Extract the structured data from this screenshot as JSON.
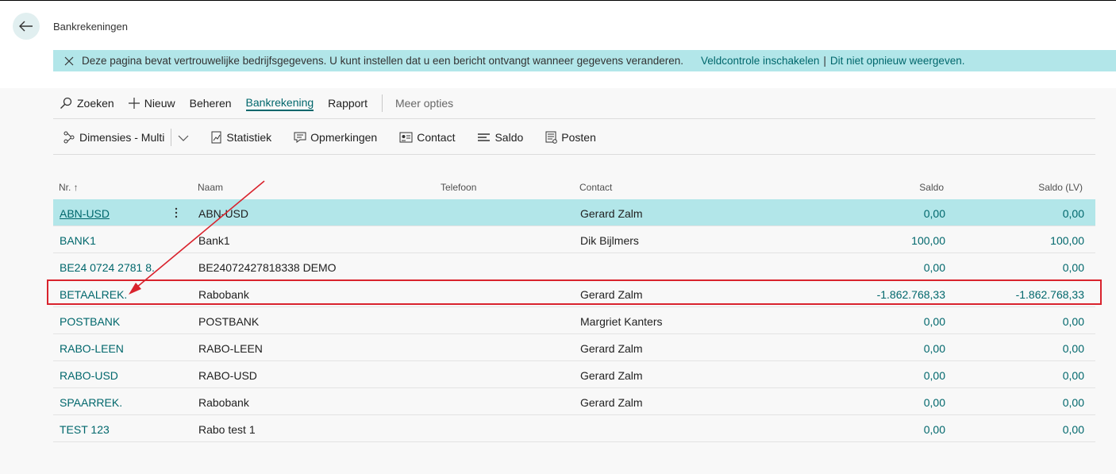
{
  "header": {
    "title": "Bankrekeningen"
  },
  "banner": {
    "message": "Deze pagina bevat vertrouwelijke bedrijfsgegevens. U kunt instellen dat u een bericht ontvangt wanneer gegevens veranderen.",
    "link1": "Veldcontrole inschakelen",
    "separator": "|",
    "link2": "Dit niet opnieuw weergeven."
  },
  "actionbar": {
    "search": "Zoeken",
    "new": "Nieuw",
    "manage": "Beheren",
    "bank_account": "Bankrekening",
    "report": "Rapport",
    "more": "Meer opties"
  },
  "toolbar": {
    "dimensions": "Dimensies - Multi",
    "statistics": "Statistiek",
    "comments": "Opmerkingen",
    "contact": "Contact",
    "balance": "Saldo",
    "entries": "Posten"
  },
  "table": {
    "headers": {
      "nr": "Nr. ↑",
      "naam": "Naam",
      "telefoon": "Telefoon",
      "contact": "Contact",
      "saldo": "Saldo",
      "saldo_lv": "Saldo (LV)"
    },
    "rows": [
      {
        "nr": "ABN-USD",
        "naam": "ABN-USD",
        "contact": "Gerard Zalm",
        "saldo": "0,00",
        "saldo_lv": "0,00"
      },
      {
        "nr": "BANK1",
        "naam": "Bank1",
        "contact": "Dik Bijlmers",
        "saldo": "100,00",
        "saldo_lv": "100,00"
      },
      {
        "nr": "BE24 0724 2781 8...",
        "naam": "BE24072427818338 DEMO",
        "contact": "",
        "saldo": "0,00",
        "saldo_lv": "0,00"
      },
      {
        "nr": "BETAALREK.",
        "naam": "Rabobank",
        "contact": "Gerard Zalm",
        "saldo": "-1.862.768,33",
        "saldo_lv": "-1.862.768,33"
      },
      {
        "nr": "POSTBANK",
        "naam": "POSTBANK",
        "contact": "Margriet Kanters",
        "saldo": "0,00",
        "saldo_lv": "0,00"
      },
      {
        "nr": "RABO-LEEN",
        "naam": "RABO-LEEN",
        "contact": "Gerard Zalm",
        "saldo": "0,00",
        "saldo_lv": "0,00"
      },
      {
        "nr": "RABO-USD",
        "naam": "RABO-USD",
        "contact": "Gerard Zalm",
        "saldo": "0,00",
        "saldo_lv": "0,00"
      },
      {
        "nr": "SPAARREK.",
        "naam": "Rabobank",
        "contact": "Gerard Zalm",
        "saldo": "0,00",
        "saldo_lv": "0,00"
      },
      {
        "nr": "TEST 123",
        "naam": "Rabo test 1",
        "contact": "",
        "saldo": "0,00",
        "saldo_lv": "0,00"
      }
    ]
  },
  "colors": {
    "accent": "#00676c",
    "selected_row": "#b2e6e9",
    "annotation": "#d9232d"
  }
}
